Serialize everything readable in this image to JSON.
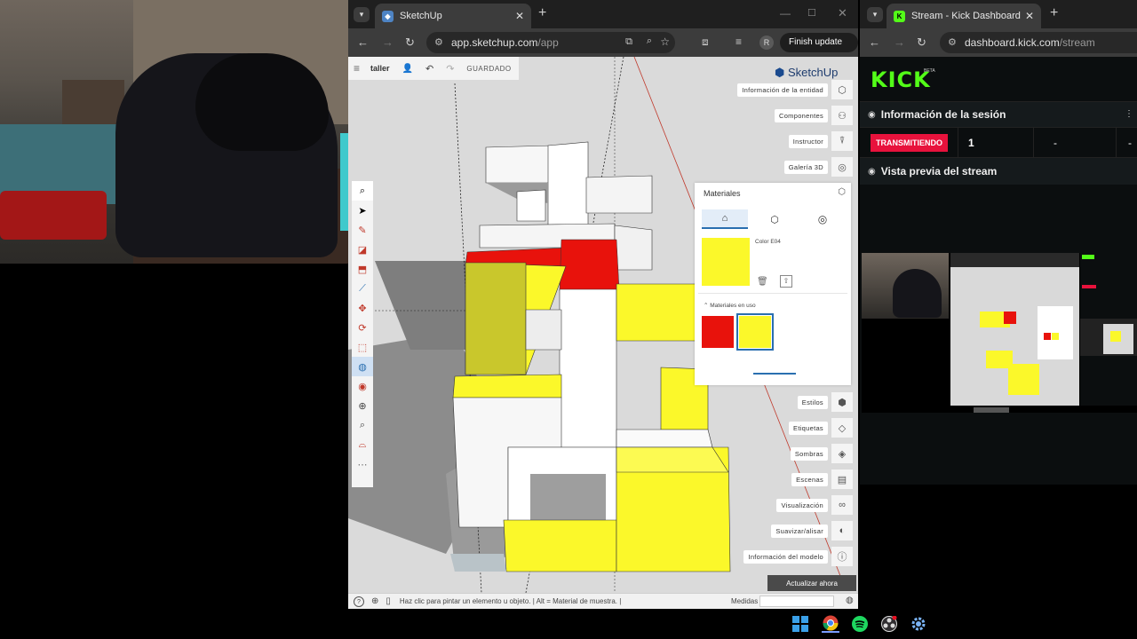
{
  "sketchup_window": {
    "tab_title": "SketchUp",
    "url_host": "app.sketchup.com",
    "url_path": "/app",
    "profile_initial": "R",
    "finish_update": "Finish update",
    "toolbar": {
      "project_name": "taller",
      "save_status": "GUARDADO"
    },
    "logo_text": "SketchUp",
    "right_panels": [
      "Información de la entidad",
      "Componentes",
      "Instructor",
      "Galería 3D",
      "Estilos",
      "Etiquetas",
      "Sombras",
      "Escenas",
      "Visualización",
      "Suavizar/alisar",
      "Información del modelo"
    ],
    "materials_panel": {
      "title": "Materiales",
      "selected_color_name": "Color E04",
      "in_use_label": "Materiales en uso",
      "swatches": [
        "#e8120c",
        "#fbf82a"
      ],
      "selected_color": "#fbf82a"
    },
    "update_now": "Actualizar ahora",
    "status_hint": "Haz clic para pintar un elemento u objeto. | Alt = Material de muestra. |",
    "measures_label": "Medidas"
  },
  "kick_window": {
    "tab_title": "Stream - Kick Dashboard",
    "url_host": "dashboard.kick.com",
    "url_path": "/stream",
    "logo": "KICK",
    "logo_badge": "BETA",
    "session_info": "Información de la sesión",
    "live_badge": "TRANSMITIENDO",
    "stat_1": "1",
    "stat_2": "-",
    "stat_3": "-",
    "preview_title": "Vista previa del stream",
    "accent": "#53fc18"
  },
  "taskbar": {
    "items": [
      "windows-icon",
      "chrome-icon",
      "spotify-icon",
      "obs-icon",
      "settings-icon"
    ]
  }
}
